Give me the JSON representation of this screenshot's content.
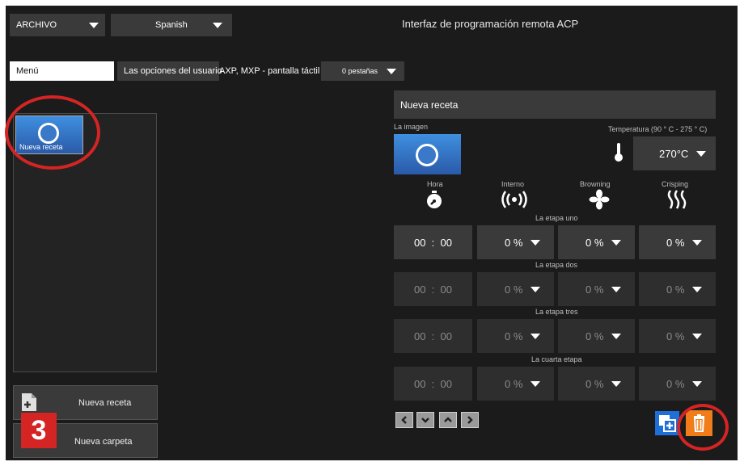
{
  "header": {
    "file_menu": "ARCHIVO",
    "language": "Spanish",
    "title": "Interfaz de programación remota ACP"
  },
  "tabs": {
    "menu": "Menú",
    "user_options": "Las opciones del usuario",
    "device": "AXP, MXP - pantalla táctil",
    "tray": "0 pestañas"
  },
  "recipe_list": {
    "items": [
      {
        "label": "Nueva receta"
      }
    ]
  },
  "actions": {
    "new_recipe": "Nueva receta",
    "new_folder": "Nueva carpeta"
  },
  "step_badge": "3",
  "editor": {
    "name": "Nueva receta",
    "image_label": "La imagen",
    "temperature_label": "Temperatura (90 ° C - 275 ° C)",
    "temperature_value": "270°C",
    "columns": [
      "Hora",
      "Interno",
      "Browning",
      "Crisping"
    ],
    "stages": [
      {
        "name": "La etapa uno",
        "time": "00  :  00",
        "interno": "0 %",
        "browning": "0 %",
        "crisping": "0 %"
      },
      {
        "name": "La etapa dos",
        "time": "00  :  00",
        "interno": "0 %",
        "browning": "0 %",
        "crisping": "0 %"
      },
      {
        "name": "La etapa tres",
        "time": "00  :  00",
        "interno": "0 %",
        "browning": "0 %",
        "crisping": "0 %"
      },
      {
        "name": "La cuarta etapa",
        "time": "00  :  00",
        "interno": "0 %",
        "browning": "0 %",
        "crisping": "0 %"
      }
    ]
  },
  "icons": [
    "chevron-left-icon",
    "chevron-down-icon",
    "chevron-up-icon",
    "chevron-right-icon",
    "add-copy-icon",
    "trash-icon",
    "thermometer-icon",
    "timer-icon",
    "signal-icon",
    "fan-icon",
    "heat-icon",
    "recipe-image-icon"
  ],
  "colors": {
    "annotation": "#d42424",
    "blue": "#1f6fd8",
    "orange": "#f07d1a",
    "badge": "#d42424"
  }
}
